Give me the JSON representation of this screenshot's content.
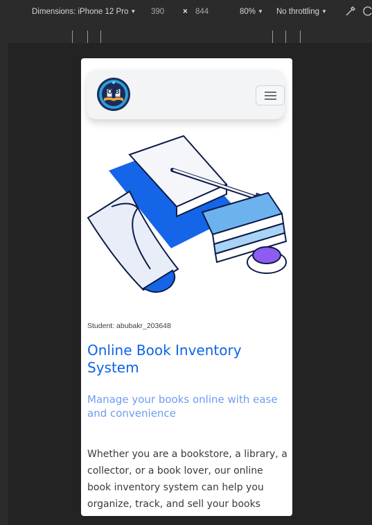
{
  "devtools": {
    "dimensions_label": "Dimensions: iPhone 12 Pro",
    "width": "390",
    "times": "×",
    "height": "844",
    "zoom": "80%",
    "throttling": "No throttling"
  },
  "icons": {
    "dimensions_caret": "triangle-down",
    "zoom_caret": "triangle-down",
    "throttle_caret": "triangle-down",
    "sensor": "eyedropper-icon",
    "rotate": "rotate-icon",
    "menu": "hamburger-icon"
  },
  "page": {
    "logo_text": "OB",
    "student": "Student: abubakr_203648",
    "title": "Online Book Inventory System",
    "subtitle": "Manage your books online with ease and convenience",
    "body": "Whether you are a bookstore, a library, a collector, or a book lover, our online book inventory system can help you organize, track, and sell your books online. Manage your inventory and"
  },
  "colors": {
    "accent": "#0d63e6",
    "subtitle": "#6e9cf0",
    "navbar_bg": "#f3f4f6"
  }
}
